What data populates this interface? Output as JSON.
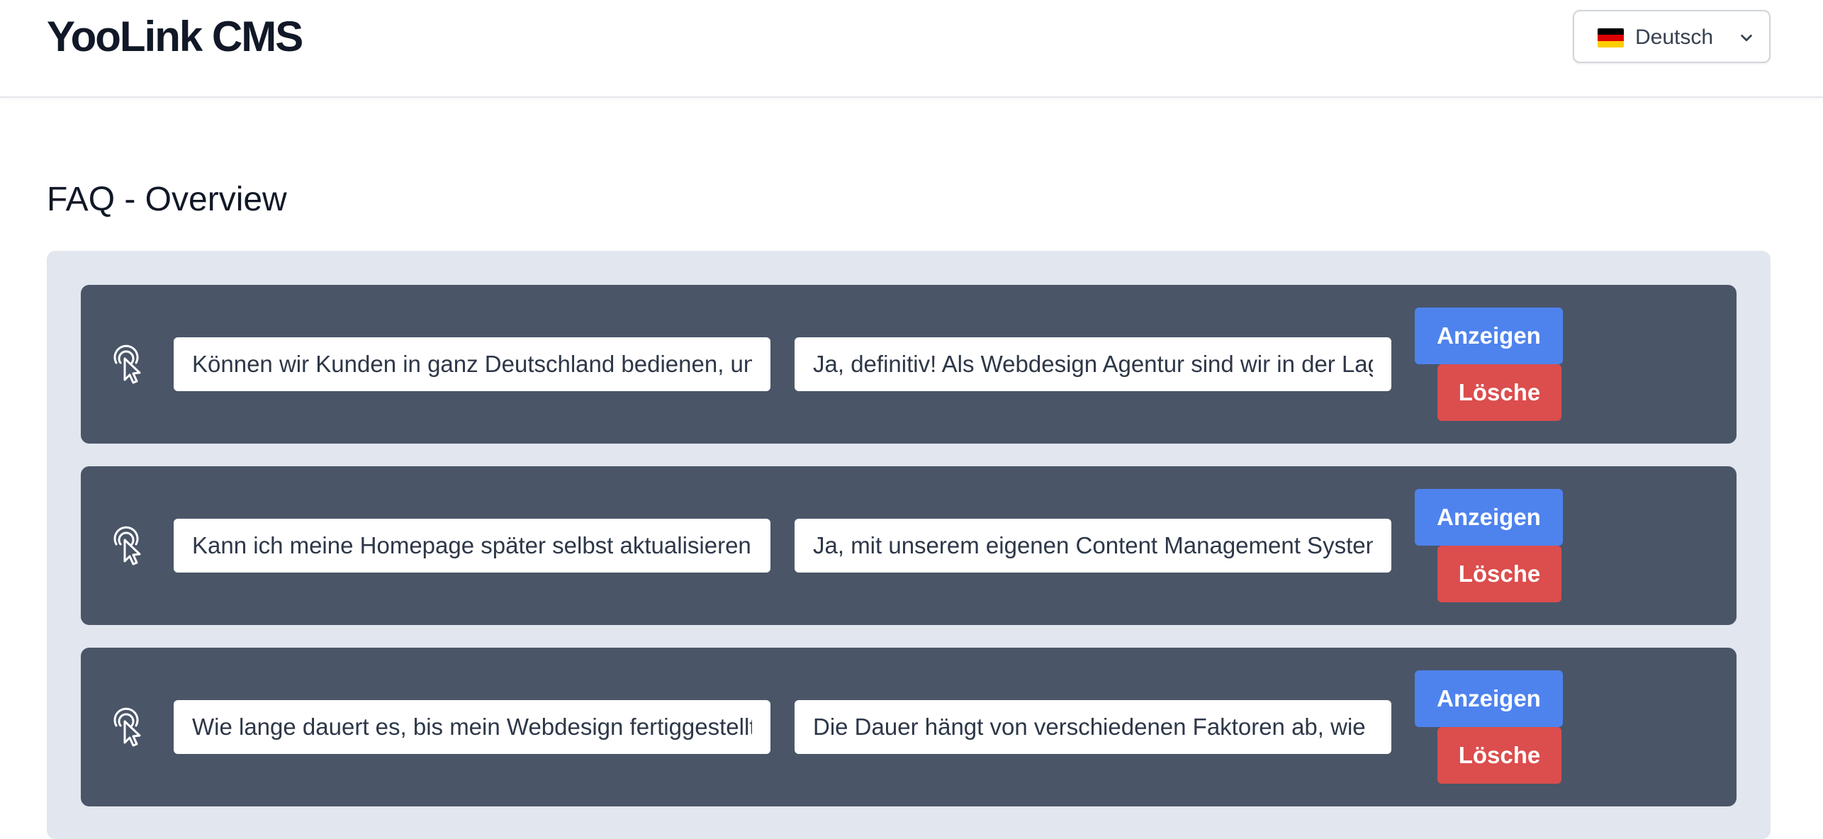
{
  "header": {
    "brand": "YooLink CMS",
    "language": {
      "selected": "Deutsch",
      "flag": "de-flag-icon",
      "flag_colors": [
        "#000000",
        "#dd0000",
        "#ffce00"
      ]
    }
  },
  "page": {
    "title": "FAQ - Overview"
  },
  "faq": {
    "items": [
      {
        "question": "Können wir Kunden in ganz Deutschland bedienen, unabhängig vom Standort?",
        "answer": "Ja, definitiv! Als Webdesign Agentur sind wir in der Lage, Kunden in ganz Deutschland zu betreuen.",
        "show_label": "Anzeigen",
        "delete_label": "Lösche"
      },
      {
        "question": "Kann ich meine Homepage später selbst aktualisieren?",
        "answer": "Ja, mit unserem eigenen Content Management System können Sie Ihre Inhalte selbst pflegen.",
        "show_label": "Anzeigen",
        "delete_label": "Lösche"
      },
      {
        "question": "Wie lange dauert es, bis mein Webdesign fertiggestellt ist?",
        "answer": "Die Dauer hängt von verschiedenen Faktoren ab, wie z. B. dem Umfang des Projekts.",
        "show_label": "Anzeigen",
        "delete_label": "Lösche"
      }
    ],
    "row_icon": "pointer-click-icon"
  },
  "colors": {
    "row_background": "#4a5568",
    "panel_background": "#e2e6ee",
    "show_button": "#4e83ee",
    "delete_button": "#dc4d4d"
  }
}
